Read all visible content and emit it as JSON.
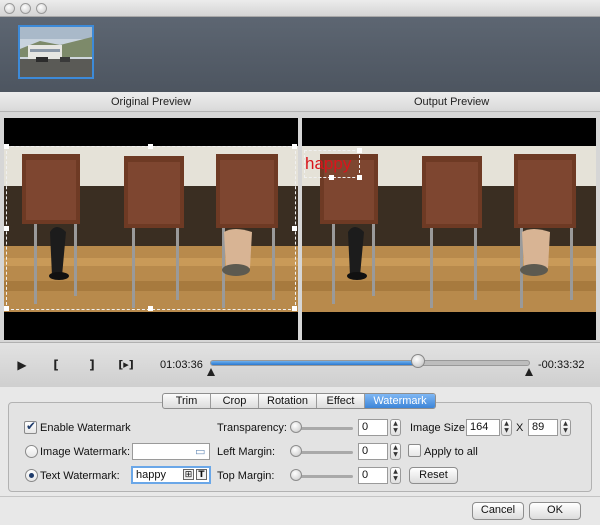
{
  "previews": {
    "original_label": "Original Preview",
    "output_label": "Output Preview",
    "watermark_text_overlay": "happy"
  },
  "transport": {
    "play_icon": "play-icon",
    "mark_in_icon": "mark-in-icon",
    "mark_out_icon": "mark-out-icon",
    "next_frame_icon": "next-frame-icon",
    "elapsed": "01:03:36",
    "remaining": "-00:33:32",
    "progress_fraction": 0.65
  },
  "tabs": [
    {
      "label": "Trim",
      "active": false
    },
    {
      "label": "Crop",
      "active": false
    },
    {
      "label": "Rotation",
      "active": false
    },
    {
      "label": "Effect",
      "active": false
    },
    {
      "label": "Watermark",
      "active": true
    }
  ],
  "watermark": {
    "enable_label": "Enable Watermark",
    "enabled": true,
    "image_watermark_label": "Image Watermark:",
    "image_watermark_value": "",
    "text_watermark_label": "Text Watermark:",
    "text_watermark_value": "happy",
    "transparency_label": "Transparency:",
    "transparency_value": "0",
    "left_margin_label": "Left Margin:",
    "left_margin_value": "0",
    "top_margin_label": "Top  Margin:",
    "top_margin_value": "0",
    "image_size_label": "Image Size:",
    "image_width": "164",
    "size_separator": "X",
    "image_height": "89",
    "apply_all_label": "Apply to all",
    "reset_label": "Reset"
  },
  "footer": {
    "cancel_label": "Cancel",
    "ok_label": "OK"
  },
  "colors": {
    "accent": "#3d85d8",
    "watermark_text": "#d9141b"
  }
}
